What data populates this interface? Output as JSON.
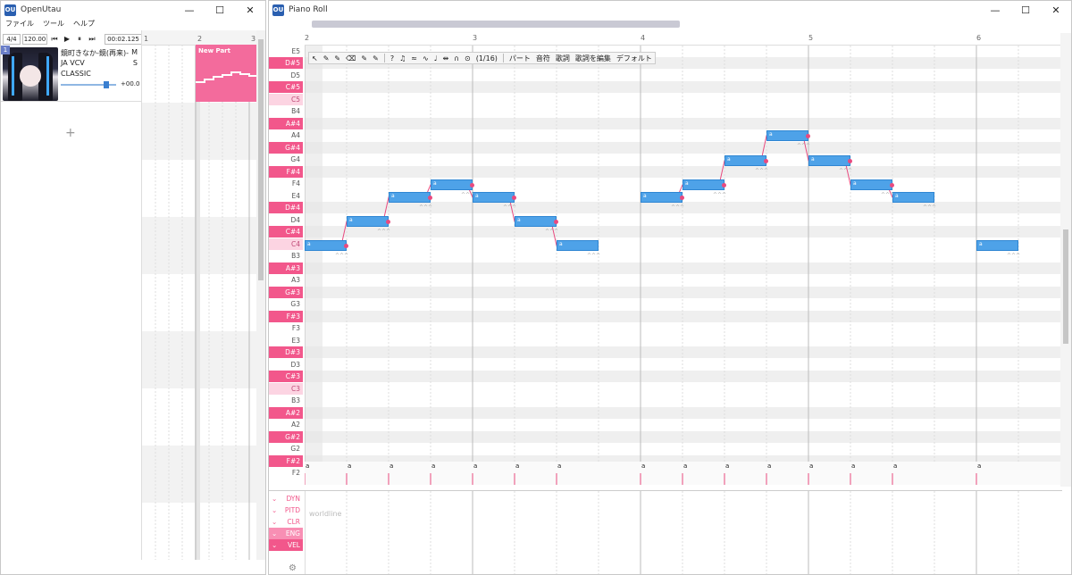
{
  "main_window": {
    "title": "OpenUtau",
    "controls": {
      "minimize": "—",
      "maximize": "☐",
      "close": "✕"
    },
    "menu": [
      "ファイル",
      "ツール",
      "ヘルプ"
    ],
    "transport": {
      "time_signature": "4/4",
      "tempo": "120.00",
      "buttons": [
        "⏮",
        "▶",
        "⏸",
        "⏭"
      ],
      "time": "00:02.125"
    },
    "track": {
      "number": "1",
      "singer": "鏡町きなか-鏡(再来)-",
      "engine": "JA VCV",
      "renderer": "CLASSIC",
      "mute": "M",
      "solo": "S",
      "volume": "+00.0"
    },
    "add_track": "+",
    "arrange": {
      "bars": [
        "1",
        "2",
        "3"
      ],
      "part_name": "New Part"
    }
  },
  "piano_window": {
    "title": "Piano Roll",
    "controls": {
      "minimize": "—",
      "maximize": "☐",
      "close": "✕"
    },
    "ruler": [
      "2",
      "3",
      "4",
      "5",
      "6"
    ],
    "toolbar": {
      "tools": [
        "↖",
        "✎",
        "✎",
        "⌫",
        "✎",
        "✎"
      ],
      "help": "?",
      "icons": [
        "♫",
        "≈",
        "∿",
        "♩",
        "⇹",
        "∩",
        "⊙"
      ],
      "snap": "(1/16)",
      "menus": [
        "パート",
        "音符",
        "歌詞",
        "歌詞を編集",
        "デフォルト"
      ]
    },
    "keys": [
      "E5",
      "D#5",
      "D5",
      "C#5",
      "C5",
      "B4",
      "A#4",
      "A4",
      "G#4",
      "G4",
      "F#4",
      "F4",
      "E4",
      "D#4",
      "D4",
      "C#4",
      "C4",
      "B3",
      "A#3",
      "A3",
      "G#3",
      "G3",
      "F#3",
      "F3",
      "E3",
      "D#3",
      "D3",
      "C#3",
      "C3",
      "B3",
      "A#2",
      "A2",
      "G#2",
      "G2",
      "F#2",
      "F2"
    ],
    "expressions": [
      "DYN",
      "PITD",
      "CLR",
      "ENG",
      "VEL"
    ],
    "expression_placeholder": "worldline",
    "note_lyric": "a",
    "vibrato_mark": "^^^",
    "settings_icon": "⚙"
  },
  "colors": {
    "accent_pink": "#f2578b",
    "note_blue": "#4ea2e8",
    "part_pink": "#f36b9c"
  }
}
